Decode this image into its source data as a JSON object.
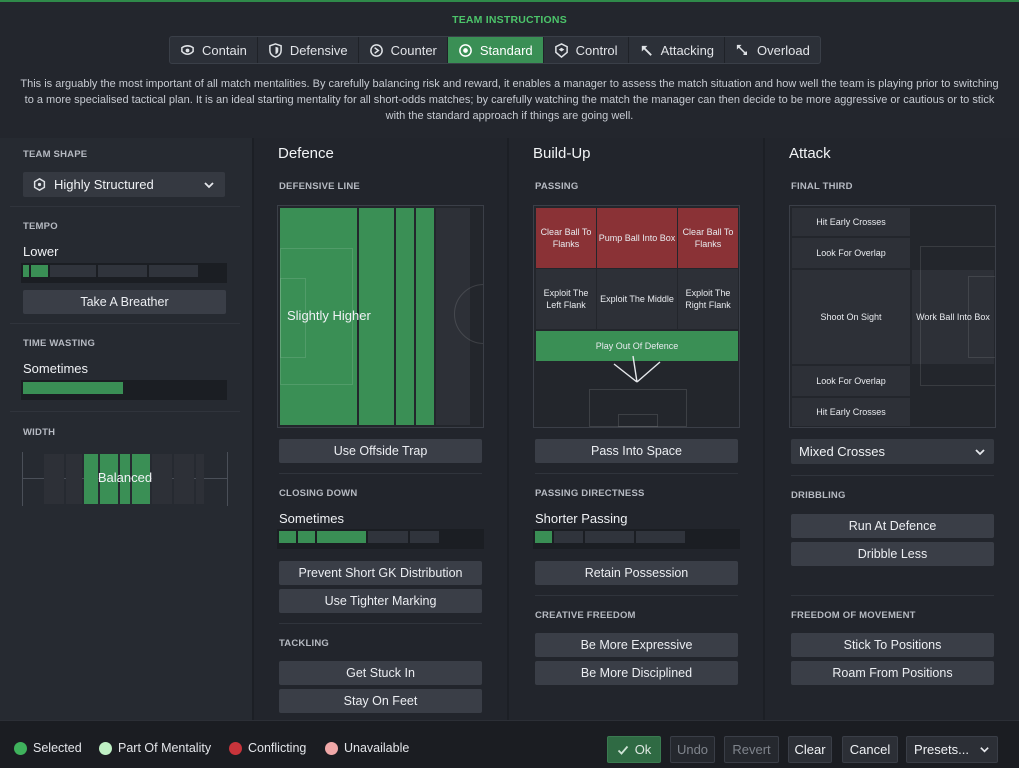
{
  "header": {
    "title": "TEAM INSTRUCTIONS",
    "tabs": [
      {
        "label": "Contain",
        "icon": "contain-shield-icon"
      },
      {
        "label": "Defensive",
        "icon": "shield-icon"
      },
      {
        "label": "Counter",
        "icon": "counter-arrow-icon"
      },
      {
        "label": "Standard",
        "icon": "standard-target-icon",
        "active": true
      },
      {
        "label": "Control",
        "icon": "control-shield-icon"
      },
      {
        "label": "Attacking",
        "icon": "attacking-arrow-icon"
      },
      {
        "label": "Overload",
        "icon": "overload-arrows-icon"
      }
    ],
    "description": "This is arguably the most important of all match mentalities. By carefully balancing risk and reward, it enables a manager to assess the match situation and how well the team is playing prior to switching to a more specialised tactical plan. It is an ideal starting mentality for all short-odds matches; by carefully watching the match the manager can then decide to be more aggressive or cautious or to stick with the standard approach if things are going well."
  },
  "left": {
    "team_shape_label": "TEAM SHAPE",
    "team_shape_value": "Highly Structured",
    "tempo_label": "TEMPO",
    "tempo_value": "Lower",
    "tempo_level": 2,
    "tempo_button": "Take A Breather",
    "time_wasting_label": "TIME WASTING",
    "time_wasting_value": "Sometimes",
    "width_label": "WIDTH",
    "width_value": "Balanced"
  },
  "defence": {
    "title": "Defence",
    "defensive_line_label": "DEFENSIVE LINE",
    "defensive_line_value": "Slightly Higher",
    "offside_button": "Use Offside Trap",
    "closing_down_label": "CLOSING DOWN",
    "closing_down_value": "Sometimes",
    "closing_down_level": 3,
    "buttons": [
      "Prevent Short GK Distribution",
      "Use Tighter Marking"
    ],
    "tackling_label": "TACKLING",
    "tackling_buttons": [
      "Get Stuck In",
      "Stay On Feet"
    ]
  },
  "buildup": {
    "title": "Build-Up",
    "passing_label": "PASSING",
    "cells": {
      "clear_left": "Clear Ball To Flanks",
      "pump": "Pump Ball Into Box",
      "clear_right": "Clear Ball To Flanks",
      "exploit_left": "Exploit The Left Flank",
      "exploit_middle": "Exploit The Middle",
      "exploit_right": "Exploit The Right Flank",
      "play_out": "Play Out Of Defence"
    },
    "pass_space_button": "Pass Into Space",
    "directness_label": "PASSING DIRECTNESS",
    "directness_value": "Shorter Passing",
    "directness_level": 1,
    "retain_button": "Retain Possession",
    "creative_label": "CREATIVE FREEDOM",
    "creative_buttons": [
      "Be More Expressive",
      "Be More Disciplined"
    ]
  },
  "attack": {
    "title": "Attack",
    "final_third_label": "FINAL THIRD",
    "cells": {
      "hit_top": "Hit Early Crosses",
      "overlap_top": "Look For Overlap",
      "shoot": "Shoot On Sight",
      "work_ball": "Work Ball Into Box",
      "overlap_bottom": "Look For Overlap",
      "hit_bottom": "Hit Early Crosses"
    },
    "crosses_value": "Mixed Crosses",
    "dribbling_label": "DRIBBLING",
    "dribbling_buttons": [
      "Run At Defence",
      "Dribble Less"
    ],
    "movement_label": "FREEDOM OF MOVEMENT",
    "movement_buttons": [
      "Stick To Positions",
      "Roam From Positions"
    ]
  },
  "footer": {
    "legend": [
      {
        "label": "Selected",
        "color": "#3fb25c"
      },
      {
        "label": "Part Of Mentality",
        "color": "#bff0c4"
      },
      {
        "label": "Conflicting",
        "color": "#c8343b"
      },
      {
        "label": "Unavailable",
        "color": "#f0a8a8"
      }
    ],
    "ok": "Ok",
    "undo": "Undo",
    "revert": "Revert",
    "clear": "Clear",
    "cancel": "Cancel",
    "presets": "Presets..."
  }
}
